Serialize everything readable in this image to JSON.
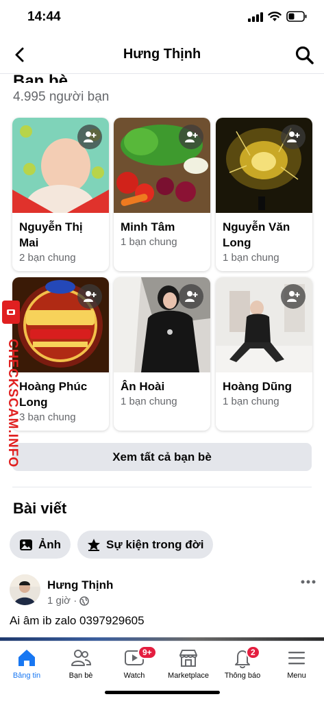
{
  "status_bar": {
    "time": "14:44"
  },
  "header": {
    "title": "Hưng Thịnh"
  },
  "friends": {
    "heading": "Bạn bè",
    "count": "4.995 người bạn",
    "items": [
      {
        "name": "Nguyễn Thị Mai",
        "mutual": "2 bạn chung"
      },
      {
        "name": "Minh Tâm",
        "mutual": "1 bạn chung"
      },
      {
        "name": "Nguyễn Văn Long",
        "mutual": "1 bạn chung"
      },
      {
        "name": "Hoàng Phúc Long",
        "mutual": "3 bạn chung"
      },
      {
        "name": "Ân Hoài",
        "mutual": "1 bạn chung"
      },
      {
        "name": "Hoàng Dũng",
        "mutual": "1 bạn chung"
      }
    ],
    "see_all": "Xem tất cả bạn bè"
  },
  "posts": {
    "heading": "Bài viết",
    "chips": [
      {
        "label": "Ảnh"
      },
      {
        "label": "Sự kiện trong đời"
      }
    ],
    "post": {
      "author": "Hưng Thịnh",
      "time": "1 giờ ·",
      "text": "Ai âm ib zalo 0397929605"
    }
  },
  "tabs": [
    {
      "label": "Bảng tin",
      "active": true
    },
    {
      "label": "Bạn bè"
    },
    {
      "label": "Watch",
      "badge": "9+"
    },
    {
      "label": "Marketplace"
    },
    {
      "label": "Thông báo",
      "badge": "2"
    },
    {
      "label": "Menu"
    }
  ],
  "watermark": "CHECKSCAM.INFO",
  "colors": {
    "accent": "#1877f2",
    "badge": "#e41e3f",
    "watermark": "#e02020"
  }
}
